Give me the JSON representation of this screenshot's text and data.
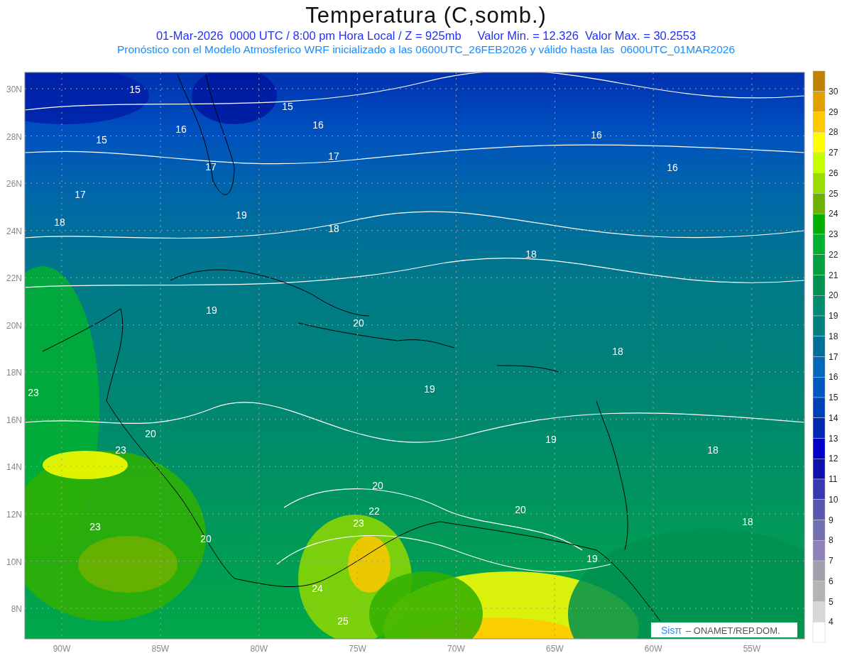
{
  "title": "Temperatura (C,somb.)",
  "subtitle": "01-Mar-2026  0000 UTC / 8:00 pm Hora Local / Z = 925mb     Valor Min. = 12.326  Valor Max. = 30.2553",
  "forecast_note": "Pronóstico con el Modelo Atmosferico WRF inicializado a las 0600UTC_26FEB2026 y válido hasta las  0600UTC_01MAR2026",
  "lat_labels": [
    "30N",
    "28N",
    "26N",
    "24N",
    "22N",
    "20N",
    "18N",
    "16N",
    "14N",
    "12N",
    "10N",
    "8N"
  ],
  "lon_labels": [
    "90W",
    "85W",
    "80W",
    "75W",
    "70W",
    "65W",
    "60W",
    "55W"
  ],
  "contour_labels": [
    "15",
    "15",
    "16",
    "16",
    "15",
    "17",
    "17",
    "16",
    "16",
    "17",
    "19",
    "18",
    "18",
    "18",
    "19",
    "20",
    "18",
    "23",
    "19",
    "20",
    "23",
    "19",
    "18",
    "20",
    "22",
    "20",
    "23",
    "18",
    "23",
    "20",
    "19",
    "24",
    "25"
  ],
  "colorbar": [
    {
      "color": "#c08000",
      "label": "30"
    },
    {
      "color": "#e0a000",
      "label": "29"
    },
    {
      "color": "#ffc800",
      "label": "28"
    },
    {
      "color": "#ffff00",
      "label": "27"
    },
    {
      "color": "#c8ff00",
      "label": "26"
    },
    {
      "color": "#98dc00",
      "label": "25"
    },
    {
      "color": "#70b000",
      "label": "24"
    },
    {
      "color": "#00b000",
      "label": "23"
    },
    {
      "color": "#00b030",
      "label": "22"
    },
    {
      "color": "#00a040",
      "label": "21"
    },
    {
      "color": "#009050",
      "label": "20"
    },
    {
      "color": "#008a70",
      "label": "19"
    },
    {
      "color": "#008080",
      "label": "18"
    },
    {
      "color": "#007098",
      "label": "17"
    },
    {
      "color": "#0068b8",
      "label": "16"
    },
    {
      "color": "#0058c0",
      "label": "15"
    },
    {
      "color": "#0040b8",
      "label": "14"
    },
    {
      "color": "#0028b0",
      "label": "13"
    },
    {
      "color": "#0000c8",
      "label": "12"
    },
    {
      "color": "#1010b0",
      "label": "11"
    },
    {
      "color": "#3838b0",
      "label": "10"
    },
    {
      "color": "#5858b0",
      "label": "9"
    },
    {
      "color": "#7070b0",
      "label": "8"
    },
    {
      "color": "#9080b8",
      "label": "7"
    },
    {
      "color": "#a0a0a8",
      "label": "6"
    },
    {
      "color": "#b4b4b4",
      "label": "5"
    },
    {
      "color": "#d8d8d8",
      "label": "4"
    },
    {
      "color": "#ffffff"
    }
  ],
  "credit": {
    "brand": "Sisπ",
    "org": "– ONAMET/REP.DOM."
  }
}
